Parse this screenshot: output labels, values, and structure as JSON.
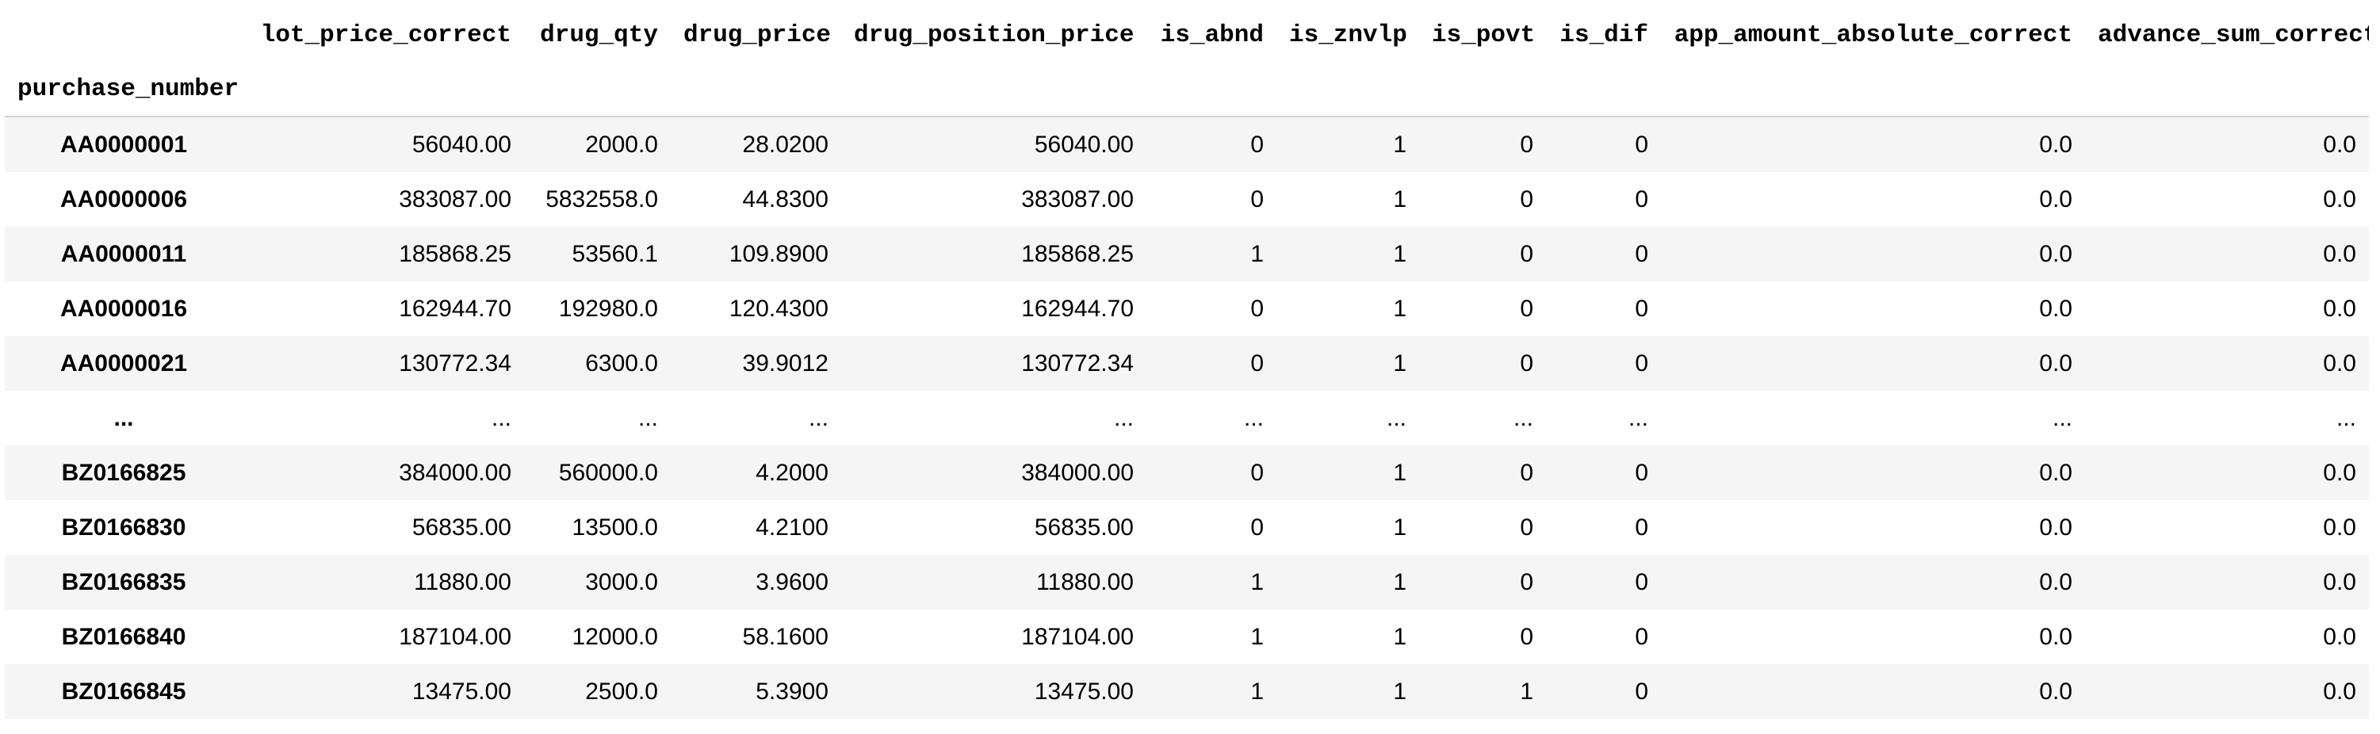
{
  "table": {
    "index_name": "purchase_number",
    "columns": [
      "lot_price_correct",
      "drug_qty",
      "drug_price",
      "drug_position_price",
      "is_abnd",
      "is_znvlp",
      "is_povt",
      "is_dif",
      "app_amount_absolute_correct",
      "advance_sum_correct"
    ],
    "rows": [
      {
        "index": "AA0000001",
        "cells": [
          "56040.00",
          "2000.0",
          "28.0200",
          "56040.00",
          "0",
          "1",
          "0",
          "0",
          "0.0",
          "0.0"
        ]
      },
      {
        "index": "AA0000006",
        "cells": [
          "383087.00",
          "5832558.0",
          "44.8300",
          "383087.00",
          "0",
          "1",
          "0",
          "0",
          "0.0",
          "0.0"
        ]
      },
      {
        "index": "AA0000011",
        "cells": [
          "185868.25",
          "53560.1",
          "109.8900",
          "185868.25",
          "1",
          "1",
          "0",
          "0",
          "0.0",
          "0.0"
        ]
      },
      {
        "index": "AA0000016",
        "cells": [
          "162944.70",
          "192980.0",
          "120.4300",
          "162944.70",
          "0",
          "1",
          "0",
          "0",
          "0.0",
          "0.0"
        ]
      },
      {
        "index": "AA0000021",
        "cells": [
          "130772.34",
          "6300.0",
          "39.9012",
          "130772.34",
          "0",
          "1",
          "0",
          "0",
          "0.0",
          "0.0"
        ]
      },
      {
        "index": "...",
        "cells": [
          "...",
          "...",
          "...",
          "...",
          "...",
          "...",
          "...",
          "...",
          "...",
          "..."
        ]
      },
      {
        "index": "BZ0166825",
        "cells": [
          "384000.00",
          "560000.0",
          "4.2000",
          "384000.00",
          "0",
          "1",
          "0",
          "0",
          "0.0",
          "0.0"
        ]
      },
      {
        "index": "BZ0166830",
        "cells": [
          "56835.00",
          "13500.0",
          "4.2100",
          "56835.00",
          "0",
          "1",
          "0",
          "0",
          "0.0",
          "0.0"
        ]
      },
      {
        "index": "BZ0166835",
        "cells": [
          "11880.00",
          "3000.0",
          "3.9600",
          "11880.00",
          "1",
          "1",
          "0",
          "0",
          "0.0",
          "0.0"
        ]
      },
      {
        "index": "BZ0166840",
        "cells": [
          "187104.00",
          "12000.0",
          "58.1600",
          "187104.00",
          "1",
          "1",
          "0",
          "0",
          "0.0",
          "0.0"
        ]
      },
      {
        "index": "BZ0166845",
        "cells": [
          "13475.00",
          "2500.0",
          "5.3900",
          "13475.00",
          "1",
          "1",
          "1",
          "0",
          "0.0",
          "0.0"
        ]
      }
    ]
  },
  "colors": {
    "stripe": "#f5f5f5",
    "header_rule": "#d4d4d4",
    "text": "#000000"
  }
}
